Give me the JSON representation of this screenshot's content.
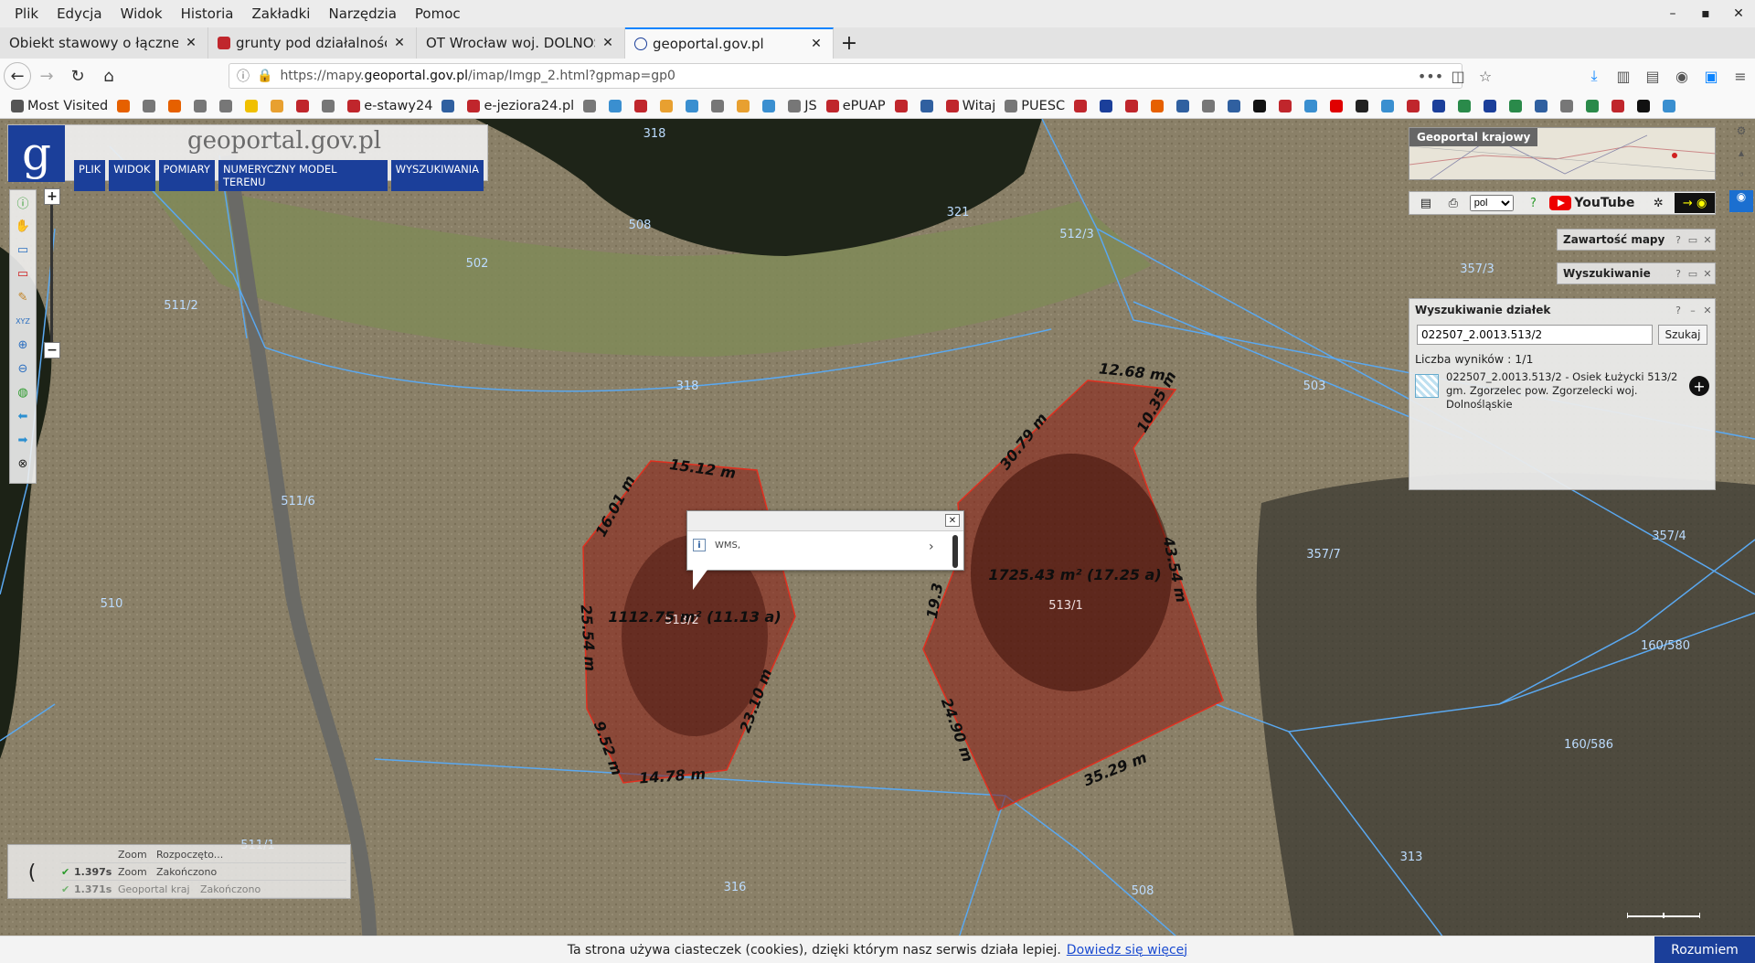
{
  "menu": [
    "Plik",
    "Edycja",
    "Widok",
    "Historia",
    "Zakładki",
    "Narzędzia",
    "Pomoc"
  ],
  "tabs": [
    {
      "title": "Obiekt stawowy o łącznej po",
      "active": false,
      "color": "#888888"
    },
    {
      "title": "grunty pod działalność ry",
      "active": false,
      "color": "#c0262c"
    },
    {
      "title": "OT Wrocław woj. DOLNOŚL",
      "active": false,
      "color": "#888888"
    },
    {
      "title": "geoportal.gov.pl",
      "active": true,
      "color": "#1b3f9a"
    }
  ],
  "url": {
    "prefix": "https://mapy.",
    "host": "geoportal.gov.pl",
    "path": "/imap/Imgp_2.html?gpmap=gp0"
  },
  "bookmarks": [
    {
      "label": "Most Visited",
      "color": "#555555"
    },
    {
      "label": "",
      "color": "#e66000"
    },
    {
      "label": "",
      "color": "#777777"
    },
    {
      "label": "",
      "color": "#e66000"
    },
    {
      "label": "",
      "color": "#777777"
    },
    {
      "label": "",
      "color": "#777777"
    },
    {
      "label": "",
      "color": "#f0c000"
    },
    {
      "label": "",
      "color": "#e8a030"
    },
    {
      "label": "",
      "color": "#c0262c"
    },
    {
      "label": "",
      "color": "#777777"
    },
    {
      "label": "e-stawy24",
      "color": "#c0262c"
    },
    {
      "label": "",
      "color": "#3060a0"
    },
    {
      "label": "e-jeziora24.pl",
      "color": "#c0262c"
    },
    {
      "label": "",
      "color": "#777777"
    },
    {
      "label": "",
      "color": "#3a8fd0"
    },
    {
      "label": "",
      "color": "#c0262c"
    },
    {
      "label": "",
      "color": "#e8a030"
    },
    {
      "label": "",
      "color": "#3a8fd0"
    },
    {
      "label": "",
      "color": "#777777"
    },
    {
      "label": "",
      "color": "#e8a030"
    },
    {
      "label": "",
      "color": "#3a8fd0"
    },
    {
      "label": "JS",
      "color": "#777777"
    },
    {
      "label": "ePUAP",
      "color": "#c0262c"
    },
    {
      "label": "",
      "color": "#c0262c"
    },
    {
      "label": "",
      "color": "#3060a0"
    },
    {
      "label": "Witaj",
      "color": "#c0262c"
    },
    {
      "label": "PUESC",
      "color": "#777777"
    },
    {
      "label": "",
      "color": "#c0262c"
    },
    {
      "label": "",
      "color": "#1b3f9a"
    },
    {
      "label": "",
      "color": "#c0262c"
    },
    {
      "label": "",
      "color": "#e66000"
    },
    {
      "label": "",
      "color": "#3060a0"
    },
    {
      "label": "",
      "color": "#777777"
    },
    {
      "label": "",
      "color": "#3060a0"
    },
    {
      "label": "",
      "color": "#111111"
    },
    {
      "label": "",
      "color": "#c0262c"
    },
    {
      "label": "",
      "color": "#3a8fd0"
    },
    {
      "label": "",
      "color": "#e00000"
    },
    {
      "label": "",
      "color": "#222222"
    },
    {
      "label": "",
      "color": "#3a8fd0"
    },
    {
      "label": "",
      "color": "#c0262c"
    },
    {
      "label": "",
      "color": "#1b3f9a"
    },
    {
      "label": "",
      "color": "#2a8a4a"
    },
    {
      "label": "",
      "color": "#1b3f9a"
    },
    {
      "label": "",
      "color": "#2a8a4a"
    },
    {
      "label": "",
      "color": "#3060a0"
    },
    {
      "label": "",
      "color": "#777777"
    },
    {
      "label": "",
      "color": "#2a8a4a"
    },
    {
      "label": "",
      "color": "#c0262c"
    },
    {
      "label": "",
      "color": "#111111"
    },
    {
      "label": "",
      "color": "#3a8fd0"
    }
  ],
  "geoportal": {
    "logo_text": "geoportal.gov.pl",
    "main_menu": [
      "PLIK",
      "WIDOK",
      "POMIARY",
      "NUMERYCZNY MODEL TERENU",
      "WYSZUKIWANIA"
    ],
    "minimap_label": "Geoportal krajowy",
    "language": "pol",
    "youtube_label": "YouTube",
    "panel_contents": "Zawartość mapy",
    "panel_search": "Wyszukiwanie",
    "search": {
      "title": "Wyszukiwanie działek",
      "query": "022507_2.0013.513/2",
      "button": "Szukaj",
      "count": "Liczba wyników : 1/1",
      "result": "022507_2.0013.513/2 - Osiek Łużycki 513/2 gm. Zgorzelec pow. Zgorzelecki woj. Dolnośląskie"
    },
    "popup_text": "WMS,",
    "status": [
      {
        "check": "",
        "time": "",
        "name": "Zoom",
        "state": "Rozpoczęto..."
      },
      {
        "check": "✔",
        "time": "1.397s",
        "name": "Zoom",
        "state": "Zakończono"
      },
      {
        "check": "✔",
        "time": "1.371s",
        "name": "Geoportal kraj",
        "state": "Zakończono"
      }
    ]
  },
  "map": {
    "parcel_labels": [
      "318",
      "321",
      "508",
      "512/3",
      "502",
      "511/2",
      "318",
      "503",
      "357/3",
      "511/6",
      "510",
      "357/7",
      "357/4",
      "160/580",
      "160/586",
      "511/1",
      "316",
      "508",
      "313",
      "513/2",
      "513/1"
    ],
    "measurements_a": [
      "15.12 m",
      "16.01 m",
      "25.54 m",
      "9.52 m",
      "14.78 m",
      "23.10 m"
    ],
    "area_a": "1112.75 m² (11.13 a)",
    "measurements_b": [
      "12.68 m",
      "10.35 m",
      "30.79 m",
      "43.54 m",
      "19.3",
      "24.90 m",
      "35.29 m"
    ],
    "area_b": "1725.43 m² (17.25 a)",
    "colors": {
      "parcel_line": "#5aa8f0",
      "polygon_fill": "#8b1a10",
      "polygon_stroke": "#e03020"
    }
  },
  "cookie": {
    "text": "Ta strona używa ciasteczek (cookies), dzięki którym nasz serwis działa lepiej.",
    "link": "Dowiedz się więcej",
    "button": "Rozumiem"
  }
}
